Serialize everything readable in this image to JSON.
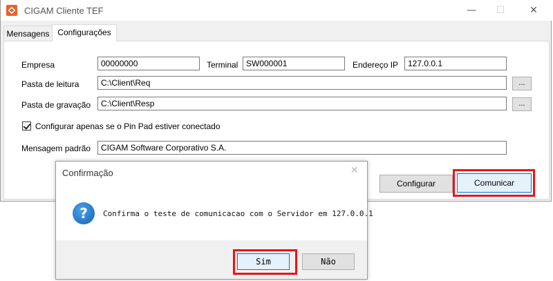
{
  "window": {
    "title": "CIGAM Cliente TEF",
    "controls": {
      "minimize": "—",
      "maximize": "☐",
      "close": "✕"
    },
    "accent": "#e8632a"
  },
  "tabs": [
    {
      "label": "Mensagens",
      "active": false
    },
    {
      "label": "Configurações",
      "active": true
    }
  ],
  "form": {
    "empresa": {
      "label": "Empresa",
      "value": "00000000"
    },
    "terminal": {
      "label": "Terminal",
      "value": "SW000001"
    },
    "endereco_ip": {
      "label": "Endereço IP",
      "value": "127.0.0.1"
    },
    "pasta_leitura": {
      "label": "Pasta de leitura",
      "value": "C:\\Client\\Req",
      "browse": "..."
    },
    "pasta_gravacao": {
      "label": "Pasta de gravação",
      "value": "C:\\Client\\Resp",
      "browse": "..."
    },
    "pinpad_checkbox": {
      "label": "Configurar apenas se o Pin Pad estiver conectado",
      "checked": true
    },
    "mensagem_padrao": {
      "label": "Mensagem padrão",
      "value": "CIGAM Software Corporativo S.A."
    }
  },
  "buttons": {
    "configurar": "Configurar",
    "comunicar": "Comunicar"
  },
  "dialog": {
    "title": "Confirmação",
    "close": "✕",
    "icon": "question-icon",
    "message": "Confirma o teste de comunicacao com o Servidor em 127.0.0.1",
    "yes": "Sim",
    "no": "Não"
  },
  "highlight_color": "#e8141a"
}
